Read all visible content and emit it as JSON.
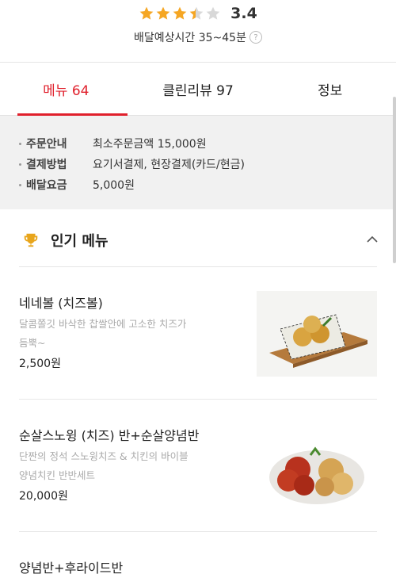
{
  "rating": {
    "value": "3.4",
    "score": 3.4,
    "star_color": "#f5a623",
    "empty_color": "#d8d8d8"
  },
  "delivery": {
    "text": "배달예상시간 35~45분",
    "help_icon": "?"
  },
  "tabs": [
    {
      "label": "메뉴 64",
      "active": true
    },
    {
      "label": "클린리뷰 97",
      "active": false
    },
    {
      "label": "정보",
      "active": false
    }
  ],
  "info": [
    {
      "key": "주문안내",
      "value": "최소주문금액 15,000원"
    },
    {
      "key": "결제방법",
      "value": "요기서결제, 현장결제(카드/현금)"
    },
    {
      "key": "배달요금",
      "value": "5,000원"
    }
  ],
  "popular": {
    "title": "인기 메뉴",
    "icon": "trophy-icon",
    "collapse_icon": "chevron-up-icon"
  },
  "menu_items": [
    {
      "name": "네네볼 (치즈볼)",
      "desc1": "달콤쫄깃 바삭한 찹쌀안에 고소한 치즈가",
      "desc2": "듬뿍~",
      "price": "2,500원"
    },
    {
      "name": "순살스노윙 (치즈) 반+순살양념반",
      "desc1": "단짠의 정석 스노윙치즈 & 치킨의 바이블",
      "desc2": "양념치킨 반반세트",
      "price": "20,000원"
    },
    {
      "name": "양념반+후라이드반",
      "desc1": "",
      "desc2": "",
      "price": ""
    }
  ],
  "colors": {
    "accent": "#e0202c",
    "info_bg": "#f1f1f1"
  }
}
